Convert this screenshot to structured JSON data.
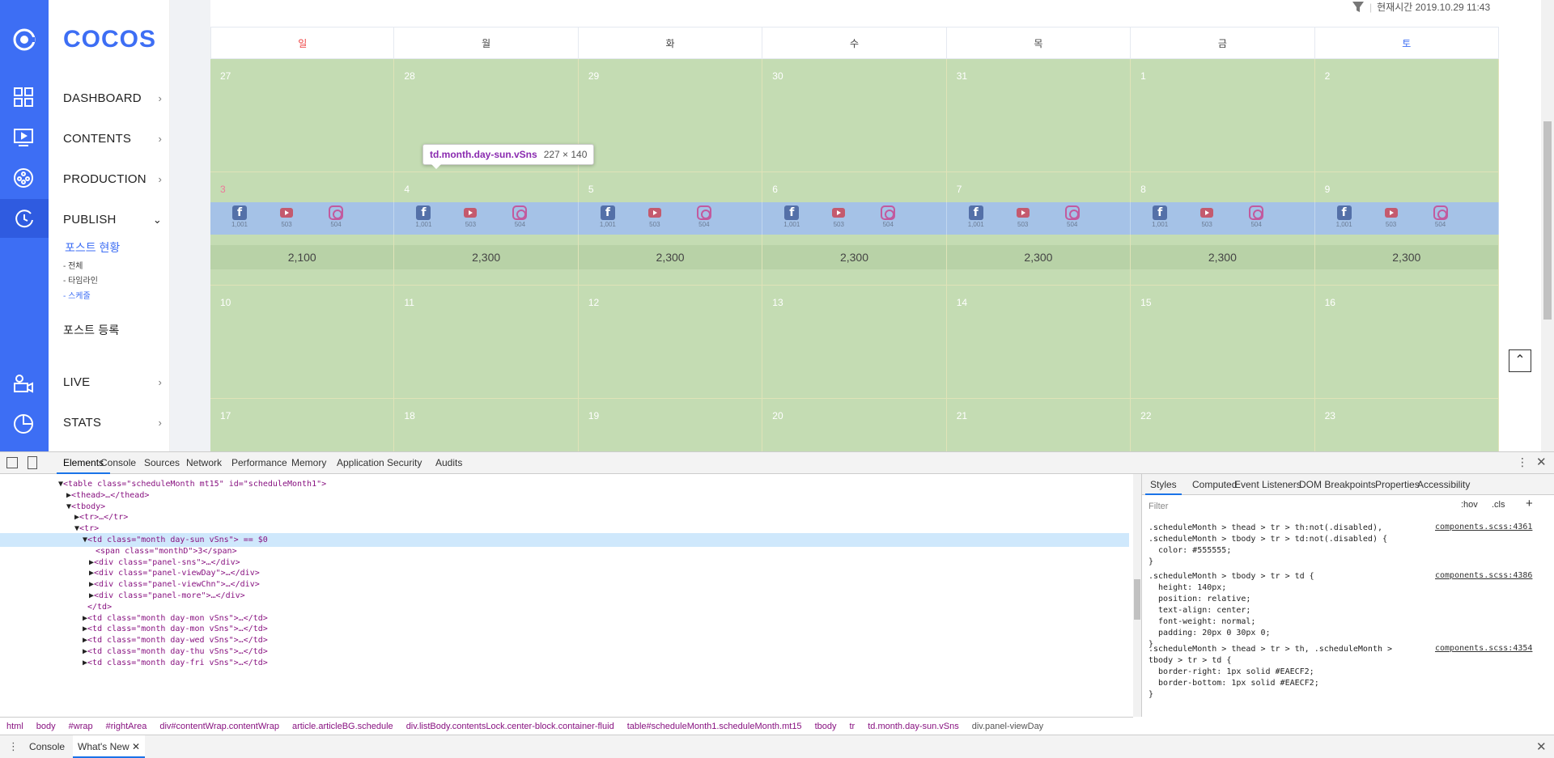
{
  "sidebar": {
    "logo": "COCOS",
    "items": [
      {
        "label": "DASHBOARD"
      },
      {
        "label": "CONTENTS"
      },
      {
        "label": "PRODUCTION"
      },
      {
        "label": "PUBLISH"
      },
      {
        "label": "LIVE"
      },
      {
        "label": "STATS"
      }
    ],
    "publish_sub": {
      "title": "포스트 현황",
      "children": [
        "- 전체",
        "- 타임라인",
        "- 스케줄"
      ],
      "register": "포스트 등록"
    }
  },
  "header": {
    "current_time": "현재시간 2019.10.29 11:43"
  },
  "calendar": {
    "weekdays": [
      "일",
      "월",
      "화",
      "수",
      "목",
      "금",
      "토"
    ],
    "weeks": [
      [
        "27",
        "28",
        "29",
        "30",
        "31",
        "1",
        "2"
      ],
      [
        "3",
        "4",
        "5",
        "6",
        "7",
        "8",
        "9"
      ],
      [
        "10",
        "11",
        "12",
        "13",
        "14",
        "15",
        "16"
      ],
      [
        "17",
        "18",
        "19",
        "20",
        "21",
        "22",
        "23"
      ]
    ],
    "sns_counts": {
      "facebook": "1,001",
      "youtube": "503",
      "instagram": "504"
    },
    "totals": [
      "2,100",
      "2,300",
      "2,300",
      "2,300",
      "2,300",
      "2,300",
      "2,300"
    ]
  },
  "tooltip": {
    "selector": "td.month.day-sun.vSns",
    "size": "227 × 140"
  },
  "devtools": {
    "tabs": [
      "Elements",
      "Console",
      "Sources",
      "Network",
      "Performance",
      "Memory",
      "Application",
      "Security",
      "Audits"
    ],
    "dom_lines": [
      "<table class=\"scheduleMonth mt15\" id=\"scheduleMonth1\">",
      "<thead>…</thead>",
      "<tbody>",
      "<tr>…</tr>",
      "<tr>",
      "<td class=\"month day-sun vSns\"> == $0",
      "<span class=\"monthD\">3</span>",
      "<div class=\"panel-sns\">…</div>",
      "<div class=\"panel-viewDay\">…</div>",
      "<div class=\"panel-viewChn\">…</div>",
      "<div class=\"panel-more\">…</div>",
      "</td>",
      "<td class=\"month day-mon vSns\">…</td>",
      "<td class=\"month day-mon vSns\">…</td>",
      "<td class=\"month day-wed vSns\">…</td>",
      "<td class=\"month day-thu vSns\">…</td>",
      "<td class=\"month day-fri vSns\">…</td>"
    ],
    "breadcrumbs": [
      "html",
      "body",
      "#wrap",
      "#rightArea",
      "div#contentWrap.contentWrap",
      "article.articleBG.schedule",
      "div.listBody.contentsLock.center-block.container-fluid",
      "table#scheduleMonth1.scheduleMonth.mt15",
      "tbody",
      "tr",
      "td.month.day-sun.vSns",
      "div.panel-viewDay"
    ],
    "style_tabs": [
      "Styles",
      "Computed",
      "Event Listeners",
      "DOM Breakpoints",
      "Properties",
      "Accessibility"
    ],
    "filter_placeholder": "Filter",
    "hov": ":hov",
    "cls": ".cls",
    "rules": [
      {
        "text": ".scheduleMonth > thead > tr > th:not(.disabled),\n.scheduleMonth > tbody > tr > td:not(.disabled) {\n  color: #555555;\n}",
        "source": "components.scss:4361"
      },
      {
        "text": ".scheduleMonth > tbody > tr > td {\n  height: 140px;\n  position: relative;\n  text-align: center;\n  font-weight: normal;\n  padding: 20px 0 30px 0;\n}",
        "source": "components.scss:4386"
      },
      {
        "text": ".scheduleMonth > thead > tr > th, .scheduleMonth >\ntbody > tr > td {\n  border-right: 1px solid #EAECF2;\n  border-bottom: 1px solid #EAECF2;\n}",
        "source": "components.scss:4354"
      }
    ],
    "drawer_tabs": [
      "Console",
      "What's New"
    ]
  },
  "colors": {
    "primary": "#3d6ef4",
    "cell_green": "#c4dcb3",
    "sns_blue": "#a5c2e7"
  }
}
